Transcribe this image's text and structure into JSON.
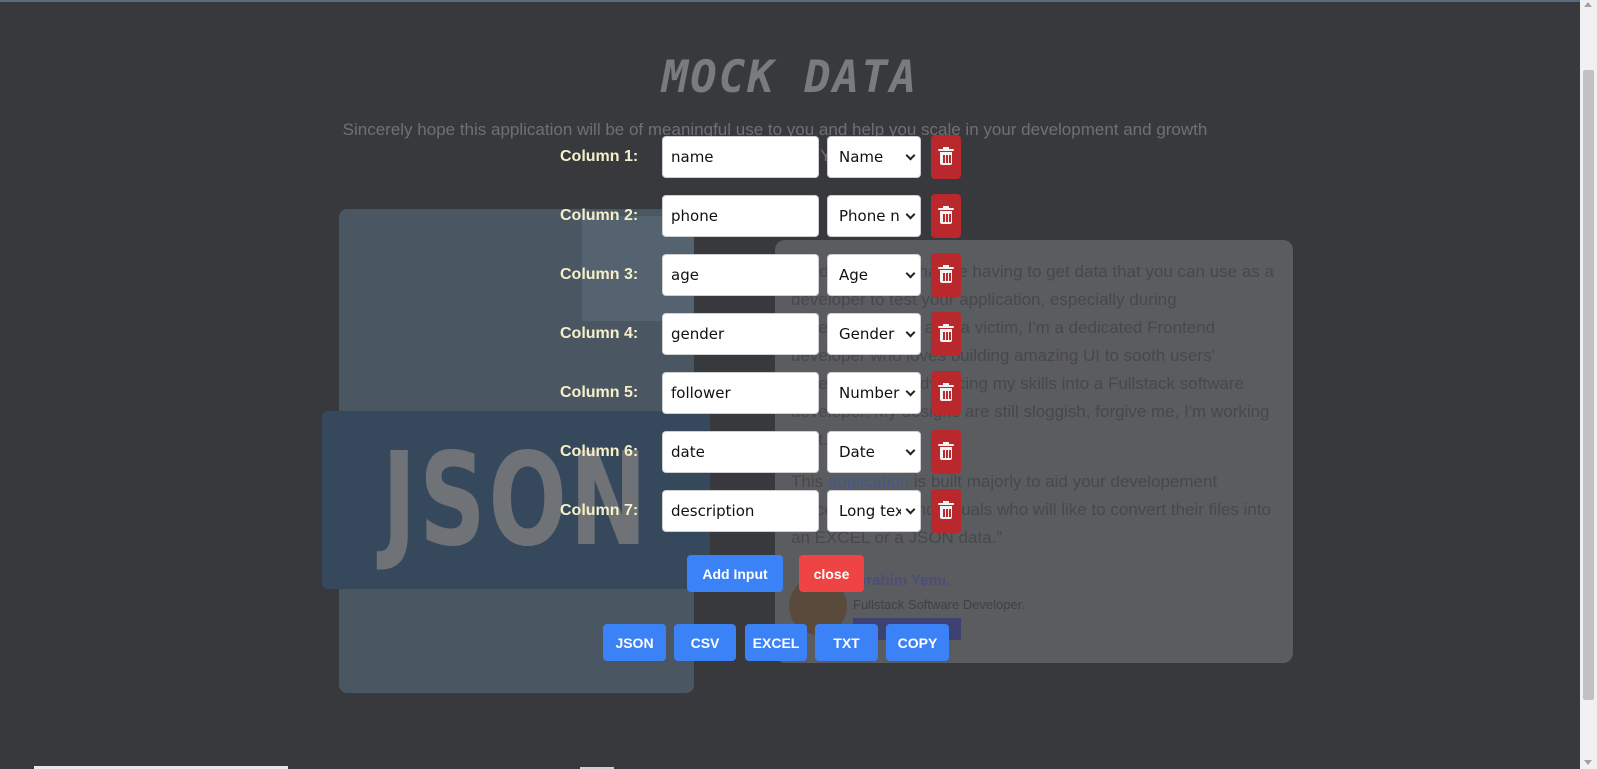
{
  "header": {
    "title": "MOCK DATA",
    "subtitle": "Sincerely hope this application will be of meaningful use to you and help you scale in your development and growth",
    "subtitle_tail": "Y"
  },
  "hero": {
    "file_label": "JSON"
  },
  "testimonial": {
    "paragraph1": "I understand the hassle having to get data that you can use as a developer to test your application, especially during development. I'm also a victim, I'm a dedicated Frontend developer who loves building amazing UI to sooth users' experience, I'm advancing my skills into a Fullstack software developer. My designs are still sloggish, forgive me, I'm working on it.",
    "paragraph2_prefix": "This ",
    "paragraph2_link": "application",
    "paragraph2_suffix": " is built majorly to aid your developement process and for individuals who will like to convert their files into an EXCEL or a JSON data.”",
    "author_name": "Ibrahim Yemi.",
    "author_role": "Fullstack Software Developer."
  },
  "columns": [
    {
      "label": "Column 1:",
      "value": "name",
      "type": "Name"
    },
    {
      "label": "Column 2:",
      "value": "phone",
      "type": "Phone n"
    },
    {
      "label": "Column 3:",
      "value": "age",
      "type": "Age"
    },
    {
      "label": "Column 4:",
      "value": "gender",
      "type": "Gender"
    },
    {
      "label": "Column 5:",
      "value": "follower",
      "type": "Number"
    },
    {
      "label": "Column 6:",
      "value": "date",
      "type": "Date"
    },
    {
      "label": "Column 7:",
      "value": "description",
      "type": "Long tex"
    }
  ],
  "actions": {
    "add_input": "Add Input",
    "close": "close"
  },
  "export": {
    "json": "JSON",
    "csv": "CSV",
    "excel": "EXCEL",
    "txt": "TXT",
    "copy": "COPY"
  },
  "colors": {
    "primary": "#3b82f6",
    "danger": "#ef4444",
    "delete": "#b8282c",
    "label": "#f5f0c8",
    "background": "#37393d"
  }
}
